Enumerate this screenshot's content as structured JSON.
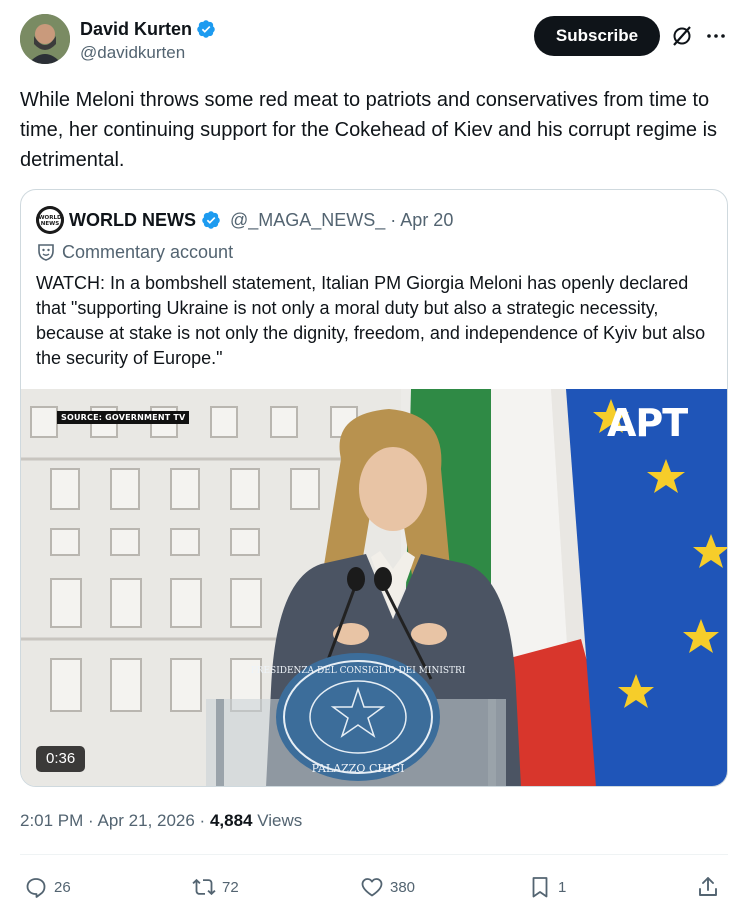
{
  "author": {
    "name": "David Kurten",
    "handle": "@davidkurten"
  },
  "header": {
    "subscribe_label": "Subscribe"
  },
  "tweet": {
    "text": "While Meloni throws some red meat to patriots and conservatives from time to time, her continuing support for the Cokehead of Kiev and his corrupt regime is detrimental."
  },
  "quote": {
    "name": "WORLD NEWS",
    "handle": "@_MAGA_NEWS_",
    "date": "· Apr 20",
    "commentary": "Commentary account",
    "text": "WATCH: In a bombshell statement, Italian PM Giorgia Meloni has openly declared that \"supporting Ukraine is not only a moral duty but also a strategic necessity, because at stake is not only the dignity, freedom, and independence of Kyiv but also the security of Europe.\"",
    "avatar_text": "WORLD NEWS",
    "media": {
      "source_label": "SOURCE: GOVERNMENT TV",
      "watermark": "APT",
      "duration": "0:36",
      "podium_text_top": "PRESIDENZA DEL CONSIGLIO DEI MINISTRI",
      "podium_text_bottom": "PALAZZO CHIGI"
    }
  },
  "meta": {
    "time": "2:01 PM · Apr 21, 2026 · ",
    "views_count": "4,884",
    "views_label": " Views"
  },
  "actions": {
    "replies": "26",
    "reposts": "72",
    "likes": "380",
    "bookmarks": "1"
  },
  "colors": {
    "verified": "#1d9bf0",
    "text_secondary": "#536471",
    "border": "#cfd9de"
  }
}
